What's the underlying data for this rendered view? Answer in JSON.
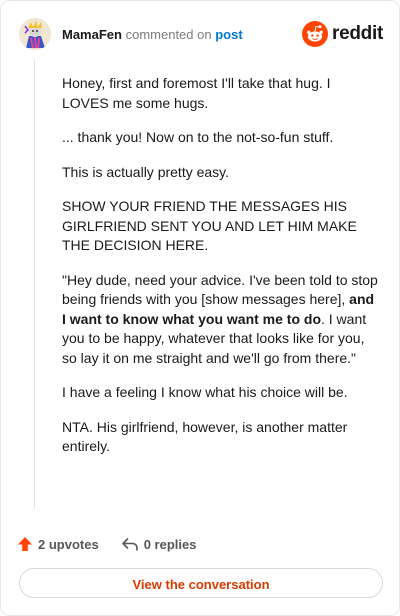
{
  "header": {
    "username": "MamaFen",
    "verb": "commented on",
    "target": "post",
    "brand": "reddit"
  },
  "comment": {
    "paragraphs": [
      "Honey, first and foremost I'll take that hug. I LOVES me some hugs.",
      "... thank you! Now on to the not-so-fun stuff.",
      "This is actually pretty easy.",
      "SHOW YOUR FRIEND THE MESSAGES HIS GIRLFRIEND SENT YOU AND LET HIM MAKE THE DECISION HERE.",
      {
        "before": "\"Hey dude, need your advice. I've been told to stop being friends with you [show messages here], ",
        "bold": "and I want to know what you want me to do",
        "after": ". I want you to be happy, whatever that looks like for you, so lay it on me straight and we'll go from there.\""
      },
      "I have a feeling I know what his choice will be.",
      "NTA. His girlfriend, however, is another matter entirely."
    ]
  },
  "actions": {
    "upvotes": "2 upvotes",
    "replies": "0 replies"
  },
  "view_button": "View the conversation",
  "colors": {
    "accent_orange": "#ff4500",
    "link_blue": "#0079d3",
    "button_text": "#d93a00"
  },
  "icons": {
    "upvote": "upvote-arrow-icon",
    "reply": "reply-arrow-icon",
    "brand": "reddit-snoo-icon"
  }
}
